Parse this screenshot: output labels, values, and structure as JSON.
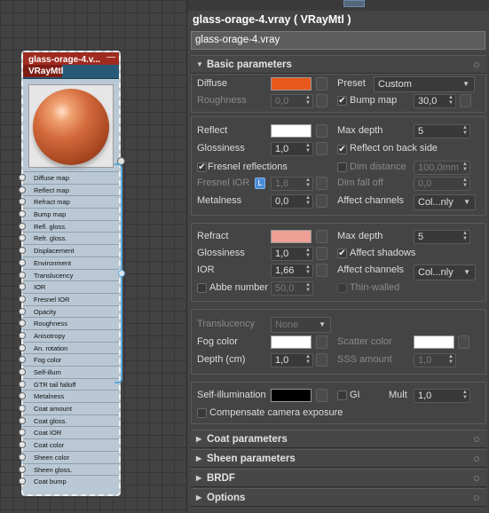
{
  "node": {
    "title": "glass-orage-4.v...",
    "subtitle": "VRayMtl",
    "sockets": [
      "Diffuse map",
      "Reflect map",
      "Refract map",
      "Bump map",
      "Refl. gloss.",
      "Refr. gloss.",
      "Displacement",
      "Environment",
      "Translucency",
      "IOR",
      "Fresnel IOR",
      "Opacity",
      "Roughness",
      "Anisotropy",
      "An. rotation",
      "Fog color",
      "Self-illum",
      "GTR tail falloff",
      "Metalness",
      "Coat amount",
      "Coat gloss.",
      "Coat IOR",
      "Coat color",
      "Sheen color",
      "Sheen gloss.",
      "Coat bump"
    ]
  },
  "panel": {
    "title": "glass-orage-4.vray  ( VRayMtl )",
    "name_value": "glass-orage-4.vray",
    "sections": {
      "basic": "Basic parameters",
      "coat": "Coat parameters",
      "sheen": "Sheen parameters",
      "brdf": "BRDF",
      "options": "Options"
    },
    "diffuse": {
      "label": "Diffuse",
      "color": "#e8581a",
      "preset_label": "Preset",
      "preset_value": "Custom",
      "roughness_label": "Roughness",
      "roughness_value": "0,0",
      "bump_label": "Bump map",
      "bump_checked": true,
      "bump_value": "30,0"
    },
    "reflect": {
      "label": "Reflect",
      "color": "#ffffff",
      "max_depth_label": "Max depth",
      "max_depth_value": "5",
      "glossiness_label": "Glossiness",
      "glossiness_value": "1,0",
      "reflect_back_label": "Reflect on back side",
      "reflect_back_checked": true,
      "fresnel_label": "Fresnel reflections",
      "fresnel_checked": true,
      "dim_distance_label": "Dim distance",
      "dim_distance_value": "100,0mm",
      "fresnel_ior_label": "Fresnel IOR",
      "fresnel_ior_lock": "L",
      "fresnel_ior_value": "1,6",
      "dim_falloff_label": "Dim fall off",
      "dim_falloff_value": "0,0",
      "metalness_label": "Metalness",
      "metalness_value": "0,0",
      "affect_channels_label": "Affect channels",
      "affect_channels_value": "Col...nly"
    },
    "refract": {
      "label": "Refract",
      "color": "#eea096",
      "max_depth_label": "Max depth",
      "max_depth_value": "5",
      "glossiness_label": "Glossiness",
      "glossiness_value": "1,0",
      "affect_shadows_label": "Affect shadows",
      "affect_shadows_checked": true,
      "ior_label": "IOR",
      "ior_value": "1,66",
      "affect_channels_label": "Affect channels",
      "affect_channels_value": "Col...nly",
      "abbe_label": "Abbe number",
      "abbe_value": "50,0",
      "thin_walled_label": "Thin-walled"
    },
    "translucency": {
      "label": "Translucency",
      "value": "None",
      "fog_color_label": "Fog color",
      "fog_color": "#ffffff",
      "scatter_color_label": "Scatter color",
      "scatter_color": "#ffffff",
      "depth_label": "Depth (cm)",
      "depth_value": "1,0",
      "sss_label": "SSS amount",
      "sss_value": "1,0"
    },
    "self_illum": {
      "label": "Self-illumination",
      "color": "#000000",
      "gi_label": "GI",
      "mult_label": "Mult",
      "mult_value": "1,0",
      "compensate_label": "Compensate camera exposure"
    }
  }
}
